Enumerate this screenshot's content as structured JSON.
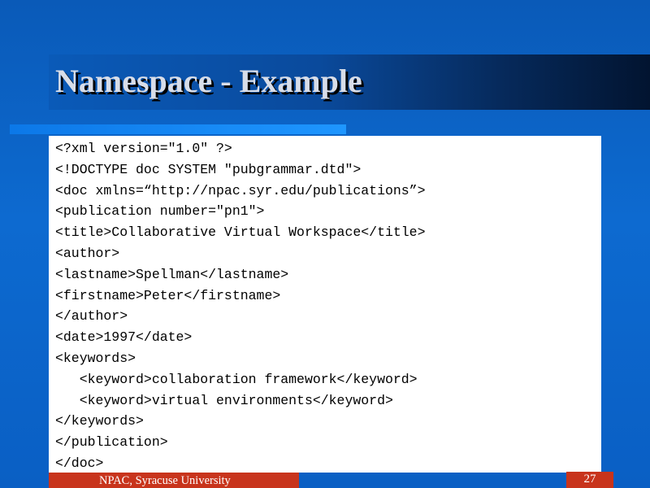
{
  "slide": {
    "title": "Namespace - Example",
    "code_lines": [
      "<?xml version=\"1.0\" ?>",
      "<!DOCTYPE doc SYSTEM \"pubgrammar.dtd\">",
      "<doc xmlns=“http://npac.syr.edu/publications”>",
      "<publication number=\"pn1\">",
      "<title>Collaborative Virtual Workspace</title>",
      "<author>",
      "<lastname>Spellman</lastname>",
      "<firstname>Peter</firstname>",
      "</author>",
      "<date>1997</date>",
      "<keywords>",
      "   <keyword>collaboration framework</keyword>",
      "   <keyword>virtual environments</keyword>",
      "</keywords>",
      "</publication>",
      "</doc>"
    ]
  },
  "footer": {
    "organization": "NPAC, Syracuse University",
    "page_number": "27"
  },
  "colors": {
    "background": "#0a5ab8",
    "title_band_dark": "#021430",
    "accent_bar": "#1e96ff",
    "footer_red": "#c8341c",
    "title_text": "#d8dde8"
  }
}
